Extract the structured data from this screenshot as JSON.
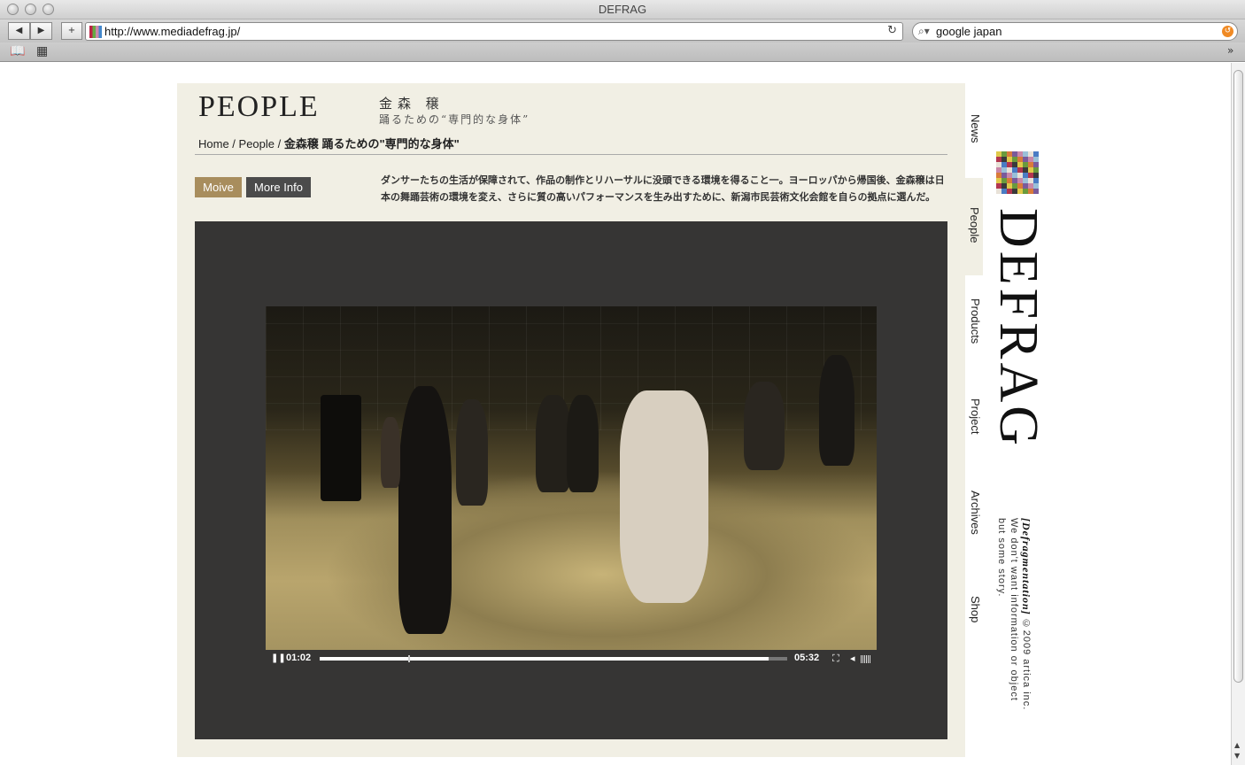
{
  "window": {
    "title": "DEFRAG"
  },
  "toolbar": {
    "back_icon": "back-arrow-icon",
    "forward_icon": "forward-arrow-icon",
    "add_icon": "plus-icon",
    "url": "http://www.mediadefrag.jp/",
    "search_value": "google japan"
  },
  "page": {
    "section_title": "PEOPLE",
    "person_name": "金森 穣",
    "person_subtitle": "踊るための“専門的な身体”",
    "breadcrumb": {
      "home": "Home",
      "sep1": " / ",
      "people": "People",
      "sep2": " / ",
      "current": "金森穣 踊るための\"専門的な身体\""
    },
    "tabs": {
      "movie": "Moive",
      "more_info": "More Info"
    },
    "description": "ダンサーたちの生活が保障されて、作品の制作とリハーサルに没頭できる環境を得ること一。ヨーロッパから帰国後、金森穣は日本の舞踊芸術の環境を変え、さらに質の高いパフォーマンスを生み出すために、新潟市民芸術文化会館を自らの拠点に選んだ。",
    "player": {
      "current_time": "01:02",
      "total_time": "05:32",
      "played_fraction": 0.19,
      "buffered_fraction": 0.96
    }
  },
  "sidenav": {
    "items": [
      {
        "label": "News"
      },
      {
        "label": "People"
      },
      {
        "label": "Products"
      },
      {
        "label": "Project"
      },
      {
        "label": "Archives"
      },
      {
        "label": "Shop"
      }
    ]
  },
  "brand": {
    "name": "DEFRAG",
    "tagline_strong": "[Defragmentation]",
    "copyright": "©2009 artica inc.",
    "tagline_1": "We don't want information or object",
    "tagline_2": "but some story."
  },
  "colors": {
    "panel_bg": "#f1efe4",
    "movie_tab": "#a88d5d",
    "info_tab": "#4b4b4b",
    "player_bg": "#363534"
  }
}
